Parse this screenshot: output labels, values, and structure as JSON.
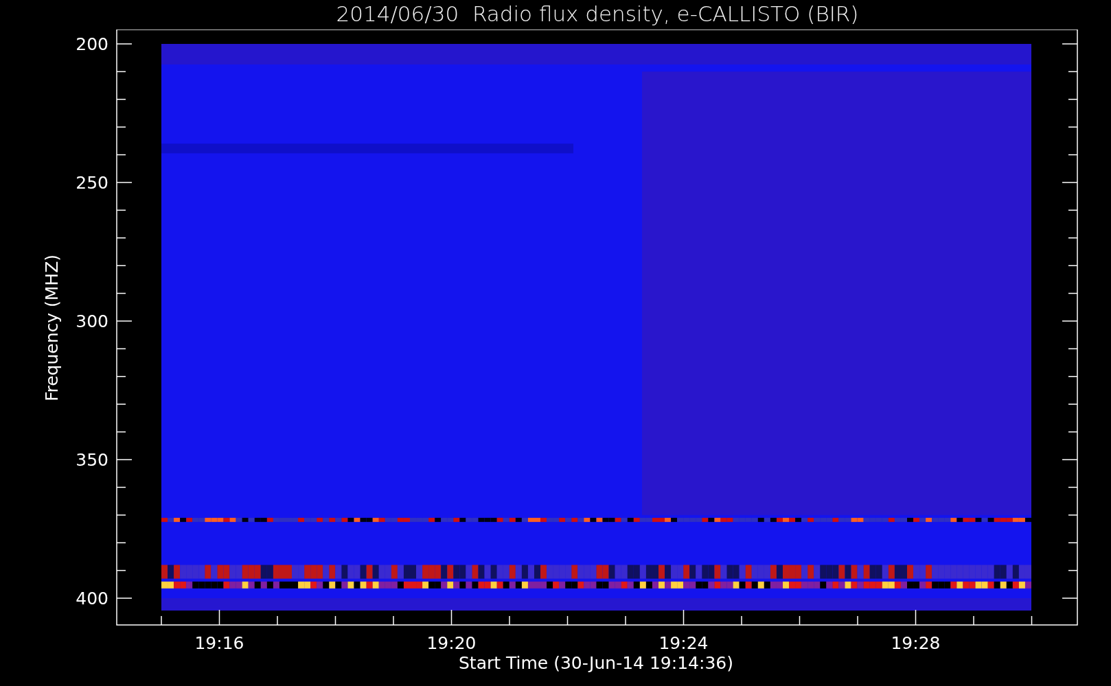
{
  "title": "2014/06/30  Radio flux density, e-CALLISTO (BIR)",
  "y_axis": {
    "label": "Frequency (MHZ)",
    "ticks": [
      "200",
      "250",
      "300",
      "350",
      "400"
    ]
  },
  "x_axis": {
    "label": "Start Time (30-Jun-14 19:14:36)",
    "ticks": [
      "19:16",
      "19:20",
      "19:24",
      "19:28"
    ]
  }
}
